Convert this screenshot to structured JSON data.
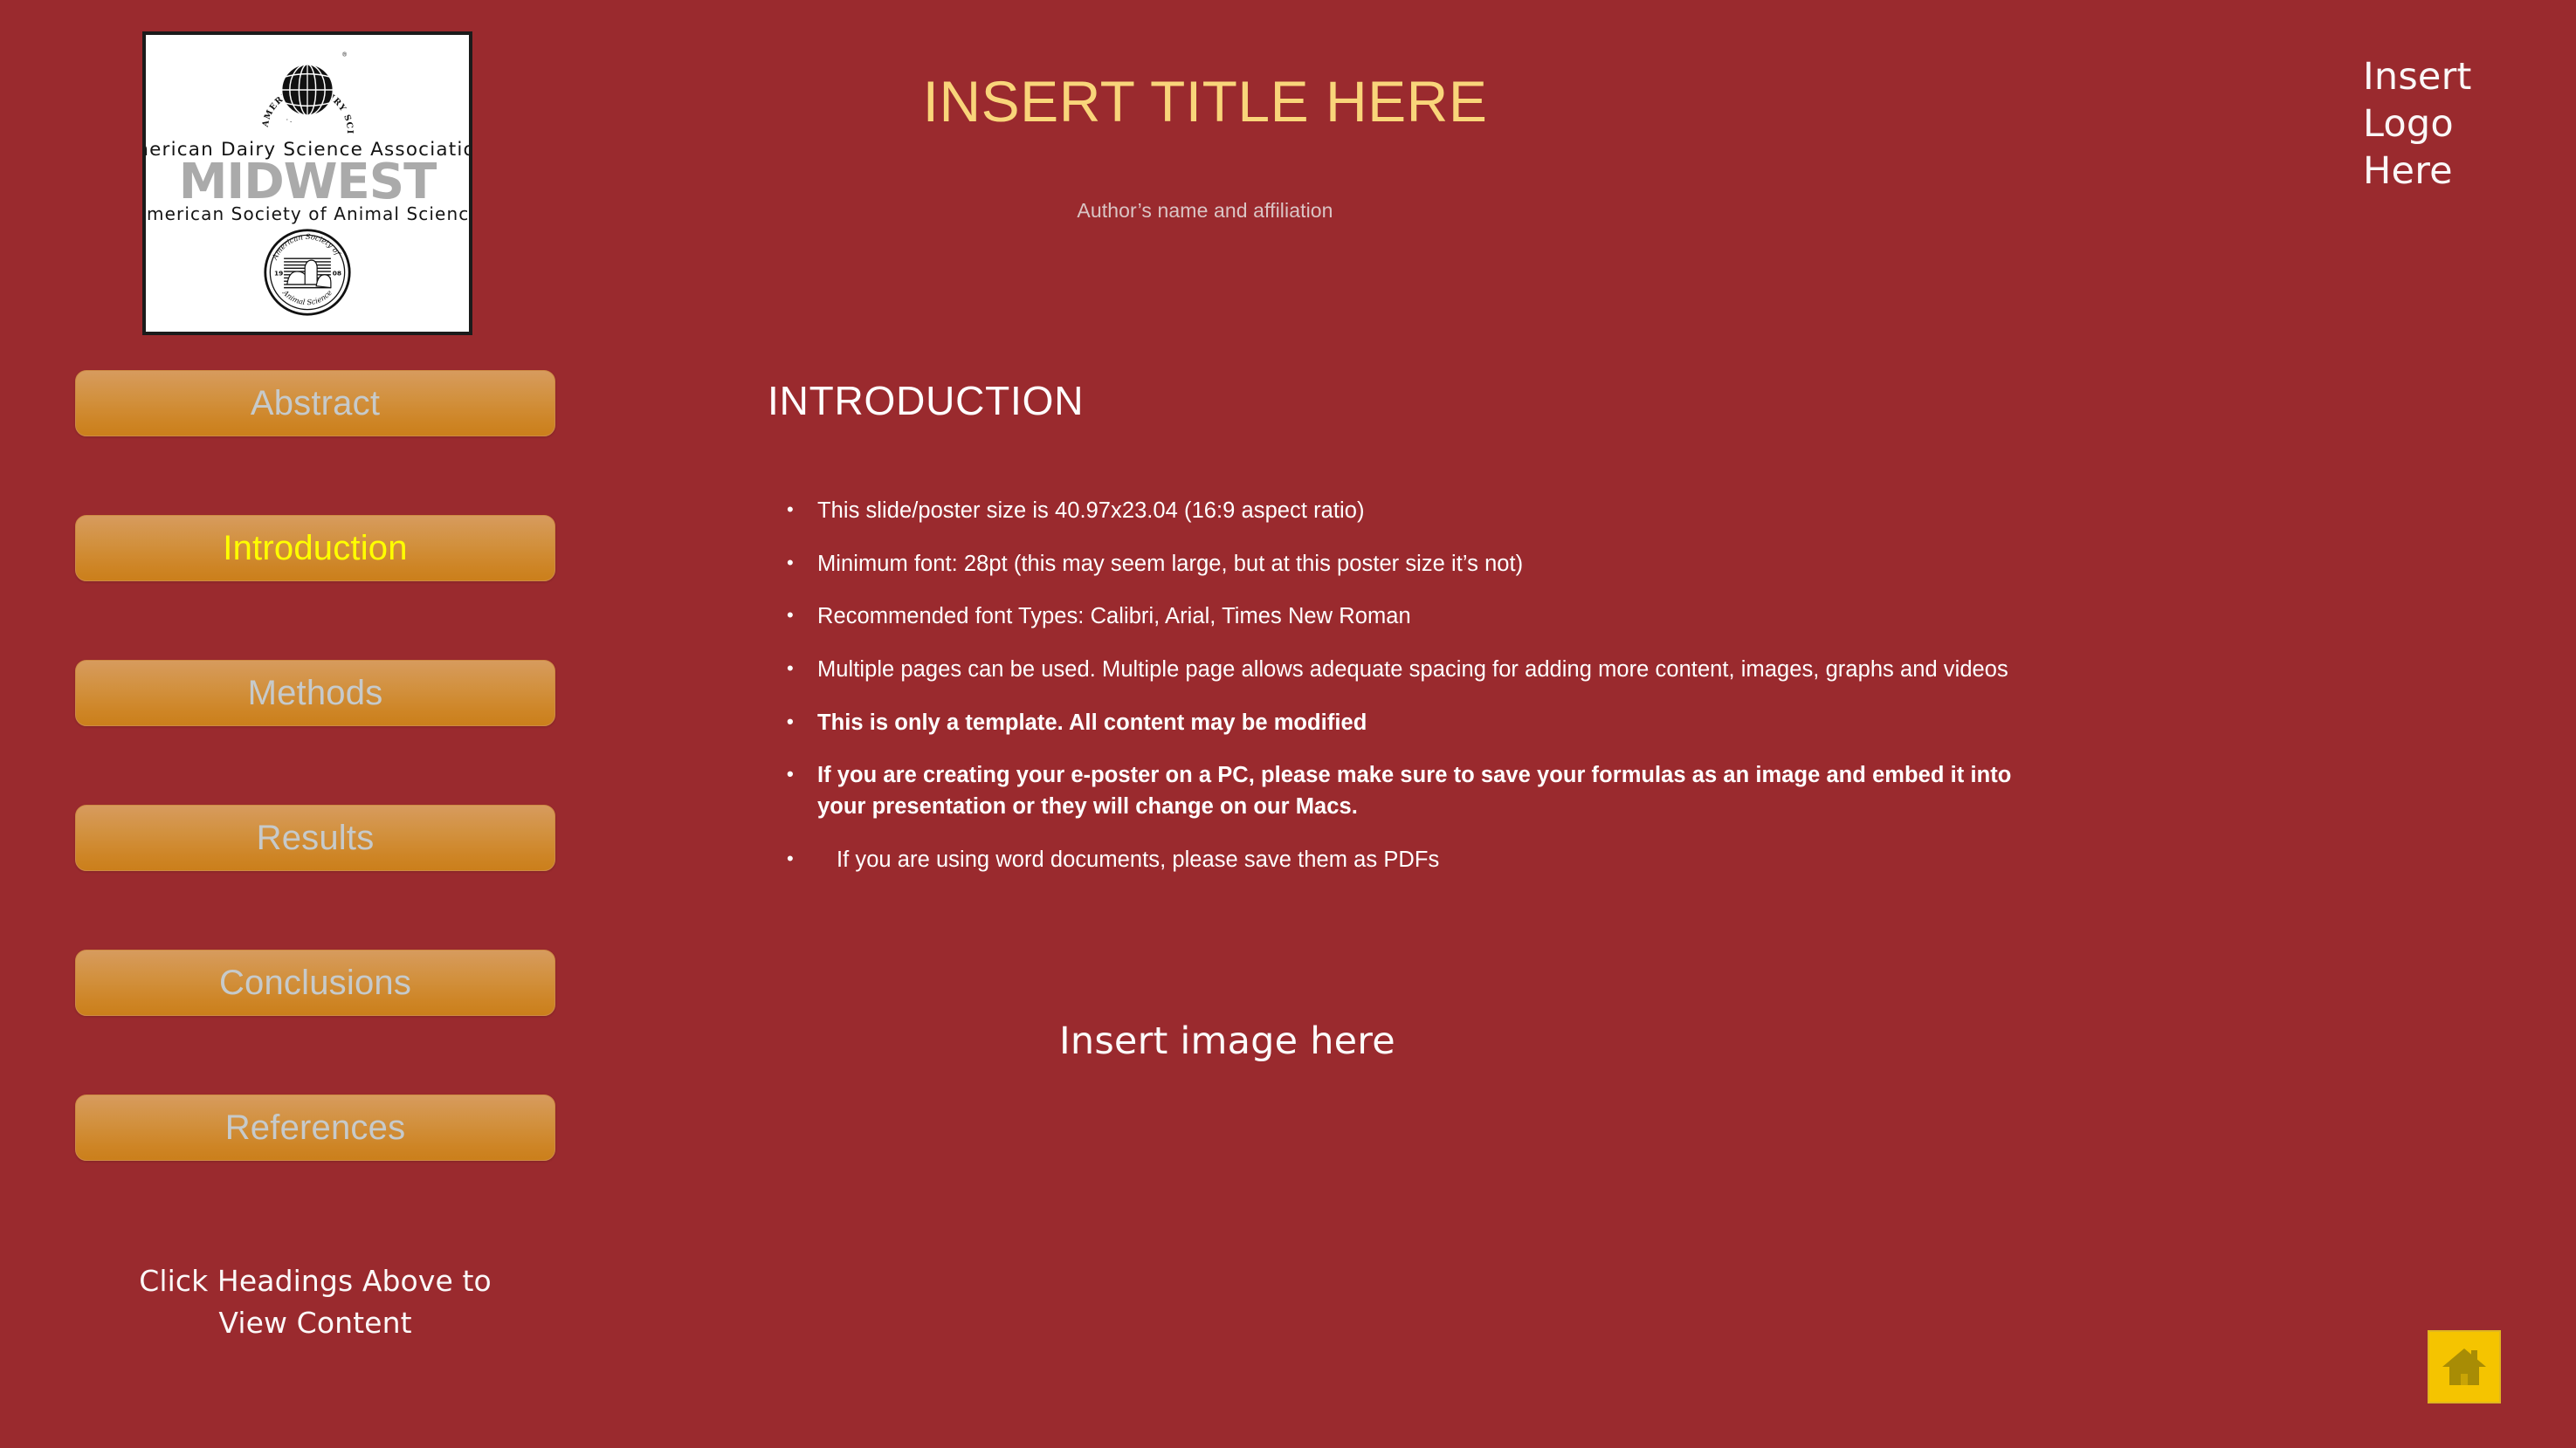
{
  "background_color": "#9A2A2E",
  "logo_panel": {
    "organization_top": "American Dairy Science Association",
    "registered_mark": "®",
    "wordmark": "MIDWEST",
    "organization_bottom": "American Society of Animal Science",
    "globe_icon_label": "adsa-globe-icon",
    "seal_icon_label": "asas-seal-icon",
    "seal_text_top": "American Society of",
    "seal_text_bottom": "Animal Science",
    "seal_year_left": "19",
    "seal_year_right": "08"
  },
  "header": {
    "title": "INSERT TITLE HERE",
    "authors": "Author’s name and affiliation",
    "title_color": "#F9D57A",
    "authors_color": "#DAC5C5",
    "logo_placeholder": "Insert\nLogo\nHere"
  },
  "sidebar": {
    "items": [
      {
        "label": "Abstract",
        "active": false
      },
      {
        "label": "Introduction",
        "active": true
      },
      {
        "label": "Methods",
        "active": false
      },
      {
        "label": "Results",
        "active": false
      },
      {
        "label": "Conclusions",
        "active": false
      },
      {
        "label": "References",
        "active": false
      }
    ],
    "hint": "Click Headings Above to\nView Content",
    "inactive_color": "#C6CACB",
    "active_color": "#FFFF00",
    "button_gradient_top": "#D79B5E",
    "button_gradient_bottom": "#CB7F1B"
  },
  "main": {
    "section_heading": "INTRODUCTION",
    "bullets": [
      {
        "text": "This slide/poster size is 40.97x23.04 (16:9 aspect ratio)",
        "bold": false,
        "extra_indent": false
      },
      {
        "text": "Minimum font: 28pt (this may seem large, but at this poster size it’s not)",
        "bold": false,
        "extra_indent": false
      },
      {
        "text": "Recommended font Types: Calibri, Arial, Times New Roman",
        "bold": false,
        "extra_indent": false
      },
      {
        "text": "Multiple pages can be used. Multiple page allows adequate spacing for adding more content, images, graphs and videos",
        "bold": false,
        "extra_indent": false
      },
      {
        "text": "This is only a template. All content may be modified",
        "bold": true,
        "extra_indent": false
      },
      {
        "text": "If you are creating your e-poster on a PC, please make sure to save your formulas as an image and embed it into your presentation or they will change on our Macs.",
        "bold": true,
        "extra_indent": false
      },
      {
        "text": "If you are using word documents, please save them as PDFs",
        "bold": false,
        "extra_indent": true
      }
    ],
    "image_placeholder": "Insert image here"
  },
  "home_button": {
    "icon": "home-icon",
    "background_color": "#F5C400",
    "icon_color": "#A88C05"
  }
}
